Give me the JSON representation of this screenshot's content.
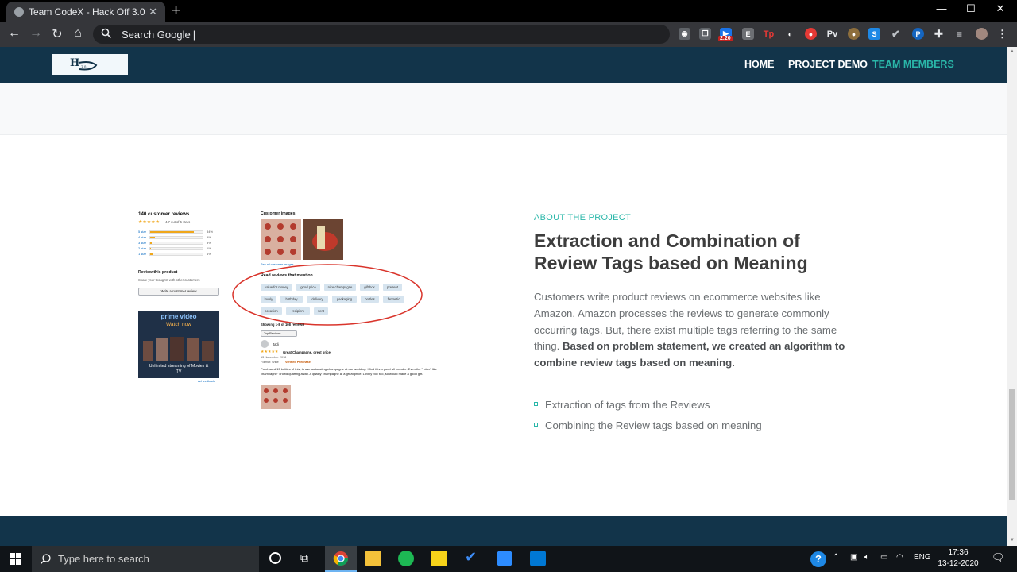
{
  "browser": {
    "tab_title": "Team CodeX - Hack Off 3.0",
    "omnibox_placeholder": "Search Google",
    "extension_badge": "2.20",
    "extensions": [
      "camera-icon",
      "copy-icon",
      "E",
      "Tp",
      "ext-icon",
      "pocket-icon",
      "Pv",
      "ext-icon",
      "S",
      "check-icon",
      "ext-icon",
      "puzzle-icon",
      "playlist-icon",
      "avatar"
    ]
  },
  "site": {
    "nav": {
      "home": "HOME",
      "project_demo": "PROJECT DEMO",
      "team_members": "TEAM MEMBERS"
    },
    "about": {
      "eyebrow": "ABOUT THE PROJECT",
      "title": "Extraction and Combination of Review Tags based on Meaning",
      "para_plain": "Customers write product reviews on ecommerce websites like Amazon. Amazon processes the reviews to generate commonly occurring tags. But, there exist multiple tags referring to the same thing. ",
      "para_bold": "Based on problem statement, we created an algorithm to combine review tags based on meaning.",
      "bullets": [
        "Extraction of tags from the Reviews",
        "Combining the Review tags based on meaning"
      ]
    },
    "amazon": {
      "reviews_count": "140 customer reviews",
      "rating": "4.7 out of 5 stars",
      "star_rows": [
        {
          "label": "5 star",
          "pct": 84,
          "pct_text": "84%"
        },
        {
          "label": "4 star",
          "pct": 9,
          "pct_text": "9%"
        },
        {
          "label": "3 star",
          "pct": 3,
          "pct_text": "3%"
        },
        {
          "label": "2 star",
          "pct": 1,
          "pct_text": "1%"
        },
        {
          "label": "1 star",
          "pct": 4,
          "pct_text": "4%"
        }
      ],
      "review_product_heading": "Review this product",
      "review_product_sub": "Share your thoughts with other customers",
      "write_review_button": "Write a customer review",
      "prime_brand": "prime video",
      "prime_watch": "Watch now",
      "prime_caption": "Unlimited streaming of Movies & TV",
      "ad_feedback": "Ad feedback",
      "customer_images": "Customer images",
      "see_all_images": "See all customer images",
      "read_reviews": "Read reviews that mention",
      "tags": [
        [
          "value for money",
          "good price",
          "nice champagne",
          "gift box",
          "present"
        ],
        [
          "lovely",
          "birthday",
          "delivery",
          "packaging",
          "bottles",
          "fantastic"
        ],
        [
          "occasion",
          "recipient",
          "sent"
        ]
      ],
      "showing": "Showing 1-8 of 108 reviews",
      "sort": "Top Reviews",
      "reviewer": "Jadi",
      "review_title": "Great Champagne, great price",
      "review_date": "13 November 2018",
      "review_format": "Format: Wine",
      "verified": "Verified Purchase",
      "review_body": "Purchased 15 bottles of this, to use as toasting champagne at our wedding. I find it is a good all rounder. Even the \"I don't like champagne\" crowd quaffing away. A quality champagne at a great price. Lovely box too, so would make a good gift."
    }
  },
  "taskbar": {
    "search_placeholder": "Type here to search",
    "lang": "ENG",
    "time": "17:36",
    "date": "13-12-2020"
  }
}
